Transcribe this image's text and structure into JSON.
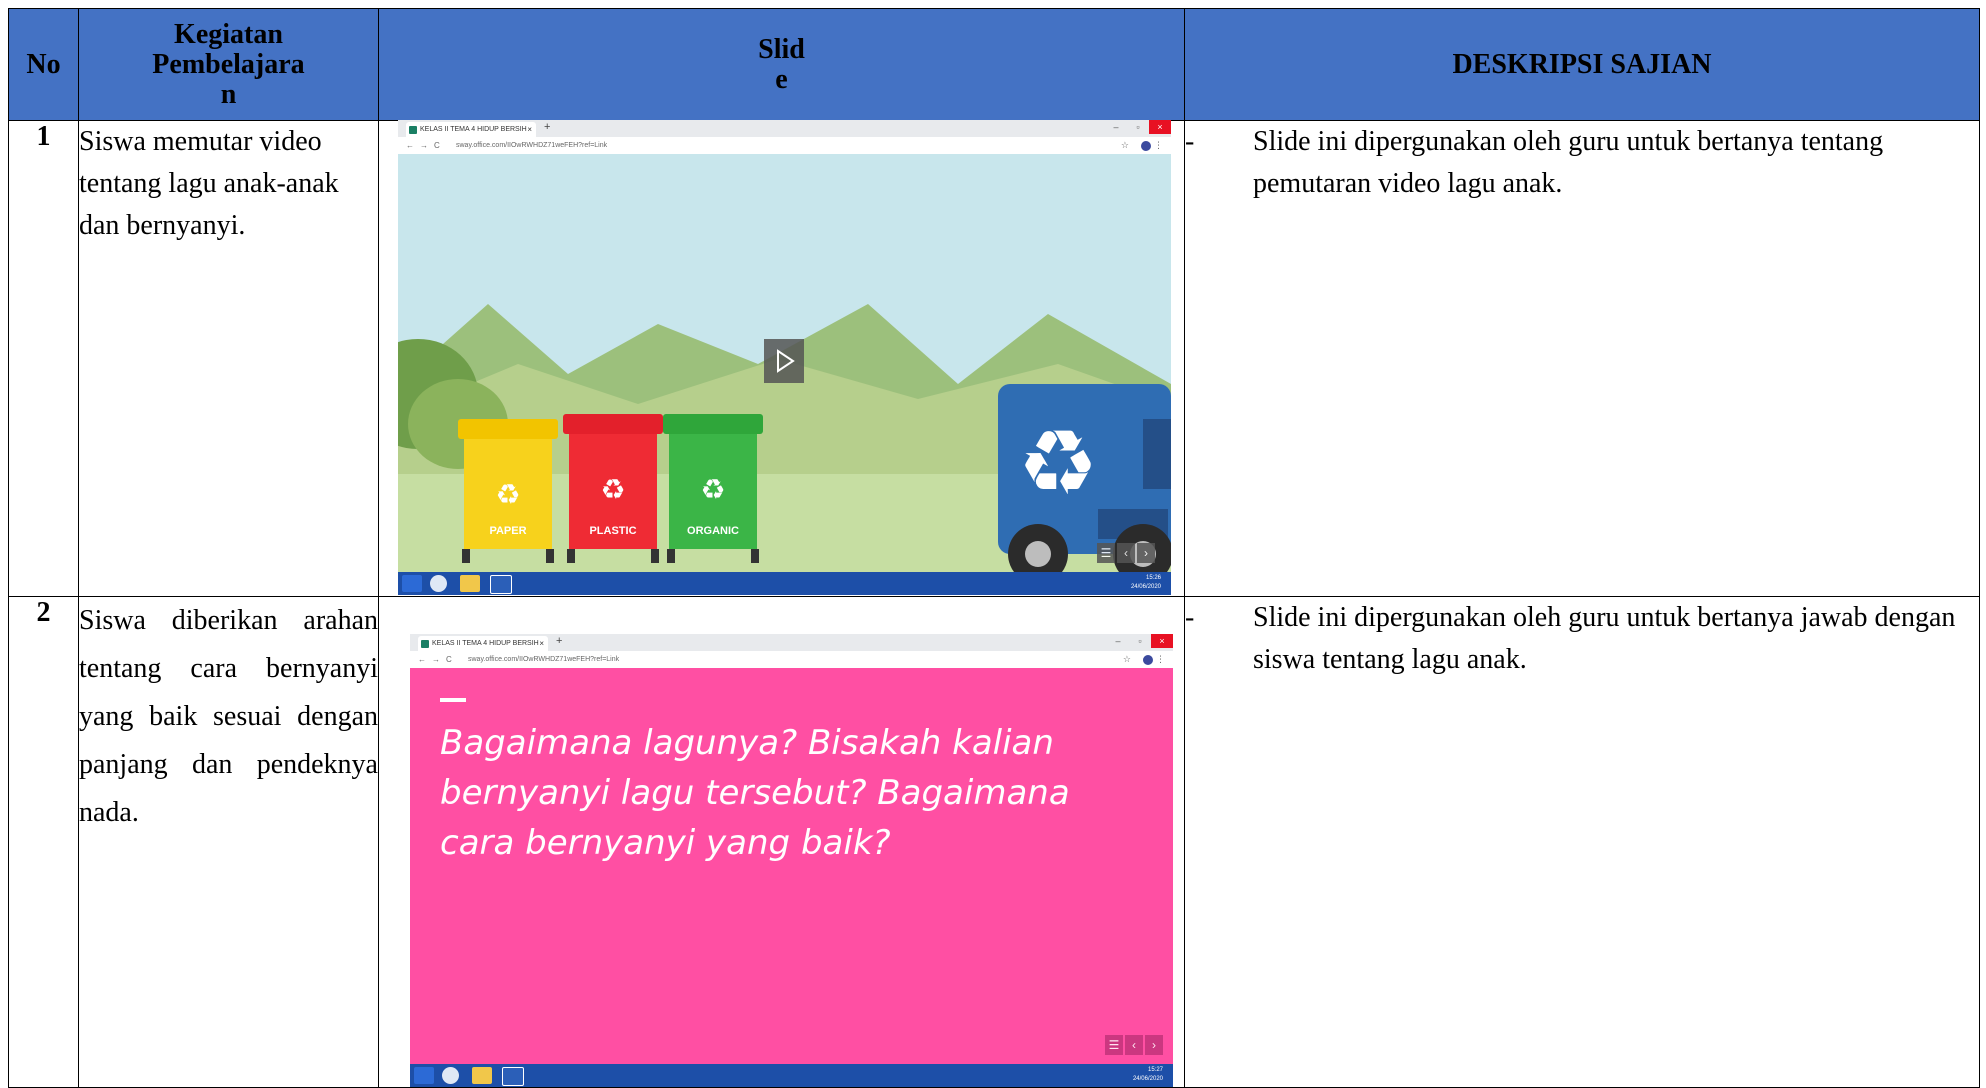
{
  "headers": {
    "no": "No",
    "kegiatan_lines": [
      "Kegiatan",
      "Pembelajara",
      "n"
    ],
    "slide_lines": [
      "Slid",
      "e"
    ],
    "deskripsi": "DESKRIPSI SAJIAN"
  },
  "rows": [
    {
      "no": "1",
      "kegiatan": "Siswa memutar video tentang lagu anak-anak dan bernyanyi.",
      "deskripsi_dash": "-",
      "deskripsi": "Slide ini dipergunakan oleh guru untuk bertanya tentang pemutaran video lagu anak."
    },
    {
      "no": "2",
      "kegiatan": "Siswa diberikan arahan tentang cara bernyanyi yang baik sesuai dengan panjang dan pendeknya nada.",
      "deskripsi_dash": "-",
      "deskripsi": "Slide ini dipergunakan oleh guru untuk bertanya jawab dengan siswa tentang lagu anak."
    }
  ],
  "screenshot1": {
    "tab_title": "KELAS II TEMA 4 HIDUP BERSIH",
    "url": "sway.office.com/IIOwRWHDZ71weFEH?ref=Link",
    "bins": [
      "PAPER",
      "PLASTIC",
      "ORGANIC"
    ],
    "clock_time": "15:26",
    "clock_date": "24/06/2020"
  },
  "screenshot2": {
    "tab_title": "KELAS II TEMA 4 HIDUP BERSIH",
    "url": "sway.office.com/IIOwRWHDZ71weFEH?ref=Link",
    "slide_text_lines": [
      "Bagaimana lagunya? Bisakah kalian",
      "bernyanyi lagu tersebut? Bagaimana",
      "cara bernyanyi yang baik?"
    ],
    "clock_time": "15:27",
    "clock_date": "24/06/2020"
  },
  "colors": {
    "header_bg": "#4472c4",
    "slide2_bg": "#ff4fa3",
    "sky": "#c8e6ec"
  }
}
